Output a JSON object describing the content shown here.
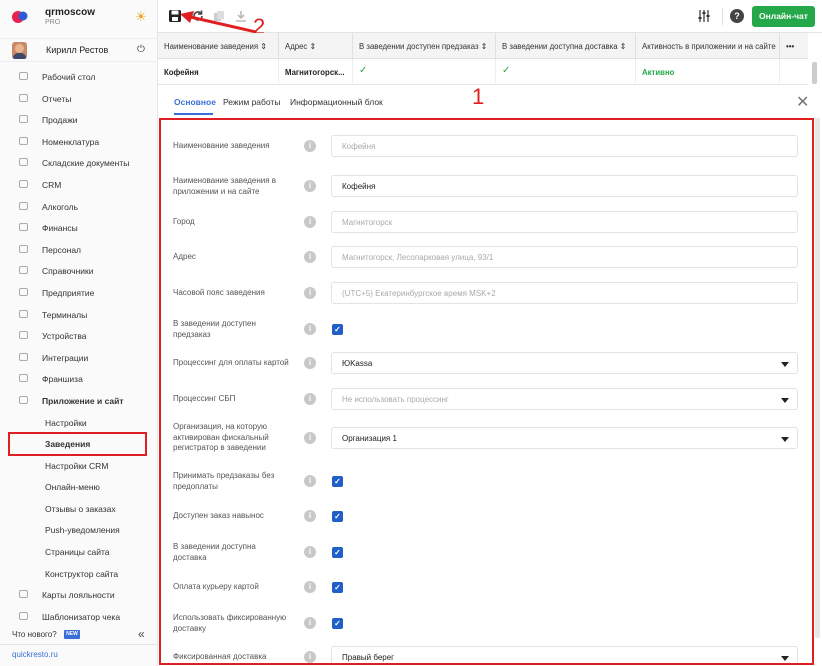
{
  "brand": {
    "name": "qrmoscow",
    "plan": "PRO"
  },
  "user": {
    "name": "Кирилл Рестов"
  },
  "sidebar": {
    "items": [
      {
        "label": "Рабочий стол"
      },
      {
        "label": "Отчеты"
      },
      {
        "label": "Продажи"
      },
      {
        "label": "Номенклатура"
      },
      {
        "label": "Складские документы"
      },
      {
        "label": "CRM"
      },
      {
        "label": "Алкоголь"
      },
      {
        "label": "Финансы"
      },
      {
        "label": "Персонал"
      },
      {
        "label": "Справочники"
      },
      {
        "label": "Предприятие"
      },
      {
        "label": "Терминалы"
      },
      {
        "label": "Устройства"
      },
      {
        "label": "Интеграции"
      },
      {
        "label": "Франшиза"
      },
      {
        "label": "Приложение и сайт"
      }
    ],
    "subitems": [
      {
        "label": "Настройки"
      },
      {
        "label": "Заведения"
      },
      {
        "label": "Настройки CRM"
      },
      {
        "label": "Онлайн-меню"
      },
      {
        "label": "Отзывы о заказах"
      },
      {
        "label": "Push-уведомления"
      },
      {
        "label": "Страницы сайта"
      },
      {
        "label": "Конструктор сайта"
      }
    ],
    "bottom_items": [
      {
        "label": "Карты лояльности"
      },
      {
        "label": "Шаблонизатор чека"
      }
    ],
    "whats_new": "Что нового?",
    "new_badge": "NEW",
    "domain": "quickresto.ru"
  },
  "toolbar": {
    "chat_label": "Онлайн-чат",
    "help": "?"
  },
  "annotations": {
    "one": "1",
    "two": "2"
  },
  "table": {
    "headers": [
      "Наименование заведения ⇕",
      "Адрес ⇕",
      "В заведении доступен предзаказ ⇕",
      "В заведении доступна доставка ⇕",
      "Активность в приложении и на сайте ⇕"
    ],
    "more": "•••",
    "row": {
      "name": "Кофейня",
      "address": "Магнитогорск...",
      "preorder": "✓",
      "delivery": "✓",
      "activity": "Активно"
    }
  },
  "tabs": [
    {
      "label": "Основное"
    },
    {
      "label": "Режим работы"
    },
    {
      "label": "Информационный блок"
    }
  ],
  "form": [
    {
      "label": "Наименование заведения",
      "value": "Кофейня",
      "filled": false
    },
    {
      "label": "Наименование заведения в приложении и на сайте",
      "value": "Кофейня",
      "filled": true
    },
    {
      "label": "Город",
      "value": "Магнитогорск",
      "filled": false
    },
    {
      "label": "Адрес",
      "value": "Магнитогорск, Лесопарковая улица, 93/1",
      "filled": false
    },
    {
      "label": "Часовой пояс заведения",
      "value": "(UTC+5) Екатеринбургское время MSK+2",
      "filled": false
    },
    {
      "label": "В заведении доступен предзаказ",
      "checked": true
    },
    {
      "label": "Процессинг для оплаты картой",
      "value": "ЮKassa",
      "filled": true
    },
    {
      "label": "Процессинг СБП",
      "value": "Не использовать процессинг",
      "filled": false
    },
    {
      "label": "Организация, на которую активирован фискальный регистратор в заведении",
      "value": "Организация 1",
      "filled": true
    },
    {
      "label": "Принимать предзаказы без предоплаты",
      "checked": true
    },
    {
      "label": "Доступен заказ навынос",
      "checked": true
    },
    {
      "label": "В заведении доступна доставка",
      "checked": true
    },
    {
      "label": "Оплата курьеру картой",
      "checked": true
    },
    {
      "label": "Использовать фиксированную доставку",
      "checked": true
    },
    {
      "label": "Фиксированная доставка",
      "value": "Правый берег",
      "filled": true
    }
  ],
  "colors": {
    "accent": "#3b6fd8",
    "chat": "#24a84a",
    "highlight": "#e02020",
    "checkbox": "#1f5fc7"
  }
}
